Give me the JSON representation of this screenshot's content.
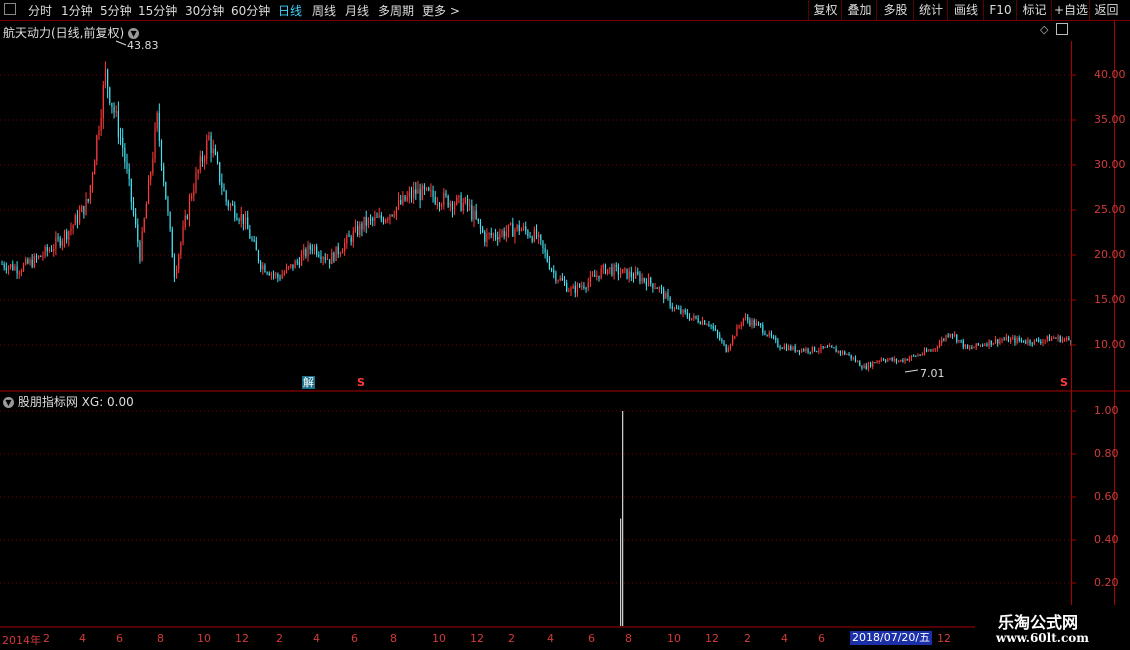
{
  "toolbar": {
    "periods": [
      {
        "label": "分时"
      },
      {
        "label": "1分钟"
      },
      {
        "label": "5分钟"
      },
      {
        "label": "15分钟"
      },
      {
        "label": "30分钟"
      },
      {
        "label": "60分钟"
      },
      {
        "label": "日线",
        "active": true
      },
      {
        "label": "周线"
      },
      {
        "label": "月线"
      },
      {
        "label": "多周期"
      },
      {
        "label": "更多 >"
      }
    ],
    "right_buttons": [
      "复权",
      "叠加",
      "多股",
      "统计",
      "画线",
      "F10",
      "标记",
      "+自选",
      "返回"
    ]
  },
  "main_chart": {
    "title": "航天动力(日线,前复权)",
    "high_label": "43.83",
    "low_label": "7.01",
    "y_ticks": [
      "40.00",
      "35.00",
      "30.00",
      "25.00",
      "20.00",
      "15.00",
      "10.00"
    ],
    "markers": {
      "jie": "解",
      "s1": "S",
      "s2": "S"
    }
  },
  "indicator": {
    "title": "股朋指标网",
    "value_label": "XG: 0.00",
    "y_ticks": [
      "1.00",
      "0.80",
      "0.60",
      "0.40",
      "0.20"
    ]
  },
  "x_axis": {
    "labels": [
      "2014年",
      "2",
      "4",
      "6",
      "8",
      "10",
      "12",
      "2",
      "4",
      "6",
      "8",
      "10",
      "12",
      "2",
      "4",
      "6",
      "8",
      "10",
      "12",
      "2",
      "4",
      "6",
      "12"
    ],
    "cursor_date": "2018/07/20/五"
  },
  "watermark": {
    "line1": "乐淘公式网",
    "line2": "www.60lt.com"
  },
  "colors": {
    "up": "#ff3b3b",
    "down": "#45e0f0",
    "grid": "#7a0000",
    "axis": "#d13b3b",
    "active": "#3fd3ff"
  },
  "chart_data": {
    "type": "candlestick",
    "ylim": [
      6,
      44
    ],
    "x": [
      "2014-01",
      "2014-02",
      "2014-03",
      "2014-04",
      "2014-05",
      "2014-06",
      "2014-07",
      "2014-08",
      "2014-09",
      "2014-10",
      "2014-11",
      "2014-12",
      "2015-01",
      "2015-02",
      "2015-03",
      "2015-04",
      "2015-05",
      "2015-06",
      "2015-07",
      "2015-08",
      "2015-09",
      "2015-10",
      "2015-11",
      "2015-12",
      "2016-01",
      "2016-02",
      "2016-03",
      "2016-04",
      "2016-05",
      "2016-06",
      "2016-07",
      "2016-08",
      "2016-09",
      "2016-10",
      "2016-11",
      "2016-12",
      "2017-01",
      "2017-02",
      "2017-03",
      "2017-04",
      "2017-05",
      "2017-06",
      "2017-07",
      "2017-08",
      "2017-09",
      "2017-10",
      "2017-11",
      "2017-12",
      "2018-01",
      "2018-02",
      "2018-03",
      "2018-04",
      "2018-05",
      "2018-06",
      "2018-07",
      "2018-08",
      "2018-09",
      "2018-10",
      "2018-11",
      "2018-12",
      "2019-01",
      "2019-02",
      "2019-03"
    ],
    "close": [
      19,
      18.5,
      19.5,
      21,
      23,
      26,
      40,
      32,
      20,
      35,
      18,
      27,
      33,
      26,
      24,
      19,
      17.5,
      19,
      21,
      19.5,
      21.5,
      23.5,
      24,
      25.5,
      27,
      26.5,
      26,
      25.5,
      22,
      22.5,
      23,
      22,
      18,
      16,
      17,
      18.5,
      18,
      17.5,
      16.5,
      14,
      13,
      12.5,
      9.5,
      13,
      12,
      10,
      9.5,
      9.5,
      9.6,
      9,
      7.5,
      8.5,
      8.2,
      8.8,
      9.5,
      11.5,
      9.5,
      10.2,
      10.6,
      10.5,
      10.4,
      10.8,
      10.5
    ],
    "xg": {
      "index": 36,
      "value": 1.0
    },
    "high": 43.83,
    "low": 7.01
  }
}
